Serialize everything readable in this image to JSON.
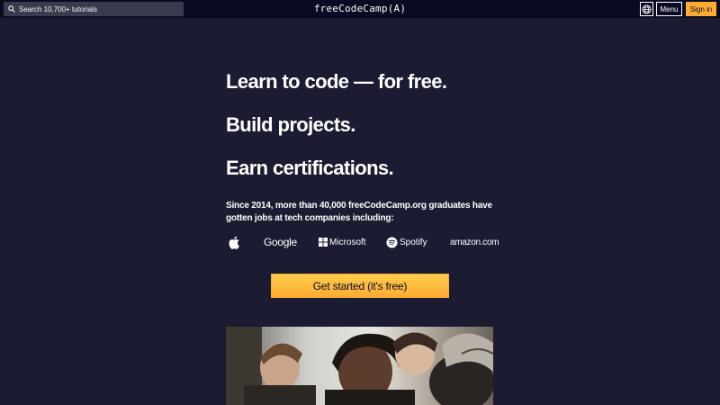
{
  "nav": {
    "search_placeholder": "Search 10,700+ tutorials",
    "logo": "freeCodeCamp(A)",
    "menu_label": "Menu",
    "signin_label": "Sign in"
  },
  "hero": {
    "headlines": [
      "Learn to code — for free.",
      "Build projects.",
      "Earn certifications."
    ],
    "subtext": "Since 2014, more than 40,000 freeCodeCamp.org graduates have gotten jobs at tech companies including:",
    "companies": [
      {
        "name": "apple",
        "label": "",
        "icon": "apple-icon"
      },
      {
        "name": "google",
        "label": "Google",
        "icon": ""
      },
      {
        "name": "microsoft",
        "label": "Microsoft",
        "icon": "microsoft-icon"
      },
      {
        "name": "spotify",
        "label": "Spotify",
        "icon": "spotify-icon"
      },
      {
        "name": "amazon",
        "label": "amazon.com",
        "icon": ""
      }
    ],
    "cta_label": "Get started (it's free)"
  },
  "colors": {
    "background": "#1b1b32",
    "nav": "#0a0a23",
    "accent": "#feac32"
  }
}
